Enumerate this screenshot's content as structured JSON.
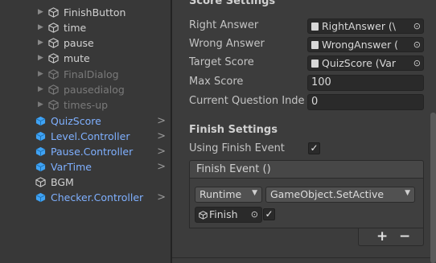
{
  "hierarchy": {
    "items": [
      {
        "label": "FinishButton",
        "type": "normal",
        "expandable": true
      },
      {
        "label": "time",
        "type": "normal",
        "expandable": true
      },
      {
        "label": "pause",
        "type": "normal",
        "expandable": true
      },
      {
        "label": "mute",
        "type": "normal",
        "expandable": true
      },
      {
        "label": "FinalDialog",
        "type": "dim",
        "expandable": true
      },
      {
        "label": "pausedialog",
        "type": "dim",
        "expandable": true
      },
      {
        "label": "times-up",
        "type": "dim",
        "expandable": true
      },
      {
        "label": "QuizScore",
        "type": "prefab",
        "chevron": ">"
      },
      {
        "label": "Level.Controller",
        "type": "prefab",
        "chevron": ">"
      },
      {
        "label": "Pause.Controller",
        "type": "prefab",
        "chevron": ">"
      },
      {
        "label": "VarTime",
        "type": "prefab",
        "chevron": ">"
      },
      {
        "label": "BGM",
        "type": "normal"
      },
      {
        "label": "Checker.Controller",
        "type": "prefab",
        "chevron": ">"
      }
    ]
  },
  "inspector": {
    "score_settings": {
      "heading": "Score Settings",
      "right_answer_label": "Right Answer",
      "right_answer_value": "RightAnswer (\\",
      "wrong_answer_label": "Wrong Answer",
      "wrong_answer_value": "WrongAnswer (",
      "target_score_label": "Target Score",
      "target_score_value": "QuizScore (Var",
      "max_score_label": "Max Score",
      "max_score_value": "100",
      "current_question_label": "Current Question Inde",
      "current_question_value": "0"
    },
    "finish_settings": {
      "heading": "Finish Settings",
      "using_finish_event_label": "Using Finish Event",
      "using_finish_event_checked": true,
      "finish_event_label": "Finish Event ()",
      "runtime_option": "Runtime",
      "function_option": "GameObject.SetActive",
      "target_object": "Finish",
      "argument_checked": true,
      "add_symbol": "+",
      "remove_symbol": "−"
    }
  },
  "colors": {
    "panel_bg": "#383838",
    "inspector_bg": "#3c3c3c",
    "prefab_blue": "#7fb0ff",
    "prefab_cube": "#3fa3f5",
    "field_bg": "#2a2a2a"
  },
  "icons": {
    "gameobject": "cube-outline-icon",
    "prefab": "cube-blue-icon",
    "object_picker": "circle-dot-icon",
    "script_asset": "document-icon"
  }
}
